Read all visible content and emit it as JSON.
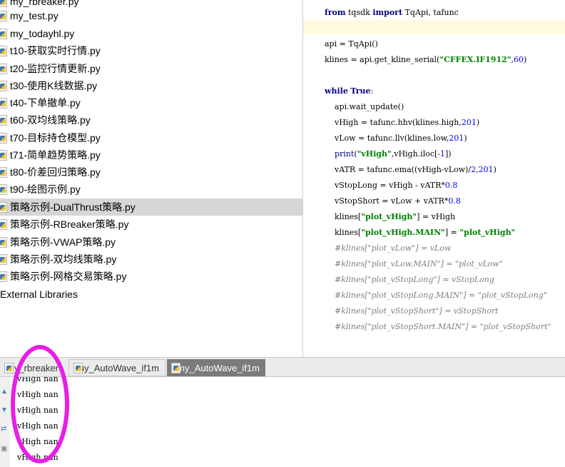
{
  "project_tree": {
    "files": [
      {
        "name": "my_rbreaker.py",
        "selected": false
      },
      {
        "name": "my_test.py",
        "selected": false
      },
      {
        "name": "my_todayhl.py",
        "selected": false
      },
      {
        "name": "t10-获取实时行情.py",
        "selected": false
      },
      {
        "name": "t20-监控行情更新.py",
        "selected": false
      },
      {
        "name": "t30-使用K线数据.py",
        "selected": false
      },
      {
        "name": "t40-下单撤单.py",
        "selected": false
      },
      {
        "name": "t60-双均线策略.py",
        "selected": false
      },
      {
        "name": "t70-目标持仓模型.py",
        "selected": false
      },
      {
        "name": "t71-简单趋势策略.py",
        "selected": false
      },
      {
        "name": "t80-价差回归策略.py",
        "selected": false
      },
      {
        "name": "t90-绘图示例.py",
        "selected": false
      },
      {
        "name": "策略示例-DualThrust策略.py",
        "selected": true
      },
      {
        "name": "策略示例-RBreaker策略.py",
        "selected": false
      },
      {
        "name": "策略示例-VWAP策略.py",
        "selected": false
      },
      {
        "name": "策略示例-双均线策略.py",
        "selected": false
      },
      {
        "name": "策略示例-网格交易策略.py",
        "selected": false
      }
    ],
    "external_libraries": "External Libraries"
  },
  "editor": {
    "lines": [
      {
        "t": 10,
        "parts": [
          {
            "k": "kw",
            "v": "from"
          },
          {
            "k": "",
            "v": " tqsdk "
          },
          {
            "k": "kw",
            "v": "import"
          },
          {
            "k": "",
            "v": " TqApi, tafunc"
          }
        ]
      },
      {
        "t": 54,
        "parts": [
          {
            "k": "",
            "v": "api = TqApi()"
          }
        ]
      },
      {
        "t": 76,
        "parts": [
          {
            "k": "",
            "v": "klines = api.get_kline_serial("
          },
          {
            "k": "str",
            "v": "\"CFFEX.IF1912\""
          },
          {
            "k": "",
            "v": ","
          },
          {
            "k": "num",
            "v": "60"
          },
          {
            "k": "",
            "v": ")"
          }
        ]
      },
      {
        "t": 120,
        "parts": [
          {
            "k": "kw",
            "v": "while"
          },
          {
            "k": "",
            "v": " "
          },
          {
            "k": "kw",
            "v": "True"
          },
          {
            "k": "",
            "v": ":"
          }
        ]
      },
      {
        "t": 142,
        "parts": [
          {
            "k": "",
            "v": "    api.wait_update()"
          }
        ]
      },
      {
        "t": 164,
        "parts": [
          {
            "k": "",
            "v": "    vHigh = tafunc.hhv(klines.high,"
          },
          {
            "k": "num",
            "v": "201"
          },
          {
            "k": "",
            "v": ")"
          }
        ]
      },
      {
        "t": 186,
        "parts": [
          {
            "k": "",
            "v": "    vLow = tafunc.llv(klines.low,"
          },
          {
            "k": "num",
            "v": "201"
          },
          {
            "k": "",
            "v": ")"
          }
        ]
      },
      {
        "t": 208,
        "parts": [
          {
            "k": "bi",
            "v": "    print"
          },
          {
            "k": "",
            "v": "("
          },
          {
            "k": "str",
            "v": "\"vHigh\""
          },
          {
            "k": "",
            "v": ",vHigh.iloc["
          },
          {
            "k": "num",
            "v": "-1"
          },
          {
            "k": "",
            "v": "])"
          }
        ]
      },
      {
        "t": 230,
        "parts": [
          {
            "k": "",
            "v": "    vATR = tafunc.ema((vHigh-vLow)/"
          },
          {
            "k": "num",
            "v": "2"
          },
          {
            "k": "",
            "v": ","
          },
          {
            "k": "num",
            "v": "201"
          },
          {
            "k": "",
            "v": ")"
          }
        ]
      },
      {
        "t": 252,
        "parts": [
          {
            "k": "",
            "v": "    vStopLong = vHigh - vATR*"
          },
          {
            "k": "num",
            "v": "0.8"
          }
        ]
      },
      {
        "t": 274,
        "parts": [
          {
            "k": "",
            "v": "    vStopShort = vLow + vATR*"
          },
          {
            "k": "num",
            "v": "0.8"
          }
        ]
      },
      {
        "t": 296,
        "parts": [
          {
            "k": "",
            "v": "    klines["
          },
          {
            "k": "str",
            "v": "\"plot_vHigh\""
          },
          {
            "k": "",
            "v": "] = vHigh"
          }
        ]
      },
      {
        "t": 318,
        "parts": [
          {
            "k": "",
            "v": "    klines["
          },
          {
            "k": "str",
            "v": "\"plot_vHigh.MAIN\""
          },
          {
            "k": "",
            "v": "] = "
          },
          {
            "k": "str",
            "v": "\"plot_vHigh\""
          }
        ]
      },
      {
        "t": 340,
        "parts": [
          {
            "k": "cmt",
            "v": "    #klines[\"plot_vLow\"] = vLow"
          }
        ]
      },
      {
        "t": 362,
        "parts": [
          {
            "k": "cmt",
            "v": "    #klines[\"plot_vLow.MAIN\"] = \"plot_vLow\""
          }
        ]
      },
      {
        "t": 384,
        "parts": [
          {
            "k": "cmt",
            "v": "    #klines[\"plot_vStopLong\"] = vStopLong"
          }
        ]
      },
      {
        "t": 406,
        "parts": [
          {
            "k": "cmt",
            "v": "    #klines[\"plot_vStopLong.MAIN\"] = \"plot_vStopLong\""
          }
        ]
      },
      {
        "t": 428,
        "parts": [
          {
            "k": "cmt",
            "v": "    #klines[\"plot_vStopShort\"] = vStopShort"
          }
        ]
      },
      {
        "t": 450,
        "parts": [
          {
            "k": "cmt",
            "v": "    #klines[\"plot_vStopShort.MAIN\"] = \"plot_vStopShort\""
          }
        ]
      }
    ]
  },
  "run_tabs": [
    {
      "label": "my_rbreaker",
      "active": false
    },
    {
      "label": "my_AutoWave_if1m",
      "active": false
    },
    {
      "label": "my_AutoWave_if1m",
      "active": true
    }
  ],
  "console": {
    "lines": [
      "vHigh nan",
      "vHigh nan",
      "vHigh nan",
      "vHigh nan",
      "vHigh nan",
      "vHigh nan"
    ]
  },
  "annotation_color": "#e81ee8"
}
